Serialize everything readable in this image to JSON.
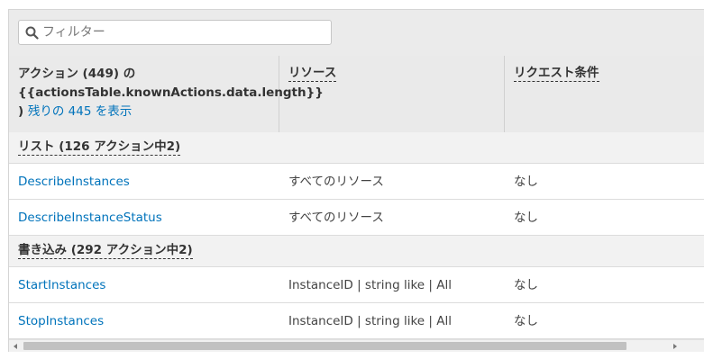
{
  "filter": {
    "placeholder": "フィルター",
    "value": "",
    "icon": "search-icon"
  },
  "columns": {
    "actions": {
      "line1": "アクション (449) の",
      "line2": "{{actionsTable.knownActions.data.length}}",
      "line3_prefix": ")",
      "line3_link": "残りの 445 を表示"
    },
    "resources": "リソース",
    "conditions": "リクエスト条件"
  },
  "groups": [
    {
      "label": "リスト (126 アクション中2)",
      "rows": [
        {
          "action": "DescribeInstances",
          "resource": "すべてのリソース",
          "condition": "なし"
        },
        {
          "action": "DescribeInstanceStatus",
          "resource": "すべてのリソース",
          "condition": "なし"
        }
      ]
    },
    {
      "label": "書き込み (292 アクション中2)",
      "rows": [
        {
          "action": "StartInstances",
          "resource": "InstanceID | string like | All",
          "condition": "なし"
        },
        {
          "action": "StopInstances",
          "resource": "InstanceID | string like | All",
          "condition": "なし"
        }
      ]
    }
  ],
  "scrollbar": {
    "thumb_fraction": 0.88,
    "left_arrow": "◂",
    "right_arrow": "▸"
  },
  "colors": {
    "link": "#0073bb",
    "header_bg": "#eaeaea",
    "group_bg": "#f2f2f2"
  }
}
